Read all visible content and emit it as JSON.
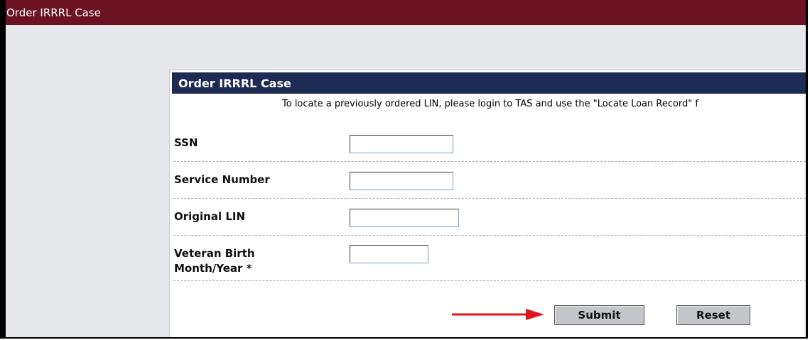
{
  "window": {
    "title": "Order IRRRL Case"
  },
  "panel": {
    "header": "Order IRRRL Case",
    "notice": "To locate a previously ordered LIN, please login to TAS and use the \"Locate Loan Record\" f"
  },
  "fields": {
    "ssn": {
      "label": "SSN",
      "value": ""
    },
    "service_number": {
      "label": "Service Number",
      "value": ""
    },
    "original_lin": {
      "label": "Original LIN",
      "value": ""
    },
    "birth": {
      "label_line1": "Veteran Birth",
      "label_line2": "Month/Year *",
      "value": ""
    }
  },
  "buttons": {
    "submit": "Submit",
    "reset": "Reset"
  },
  "colors": {
    "titlebar": "#6b1323",
    "panel_header": "#1c2b52",
    "arrow": "#e0141a"
  }
}
